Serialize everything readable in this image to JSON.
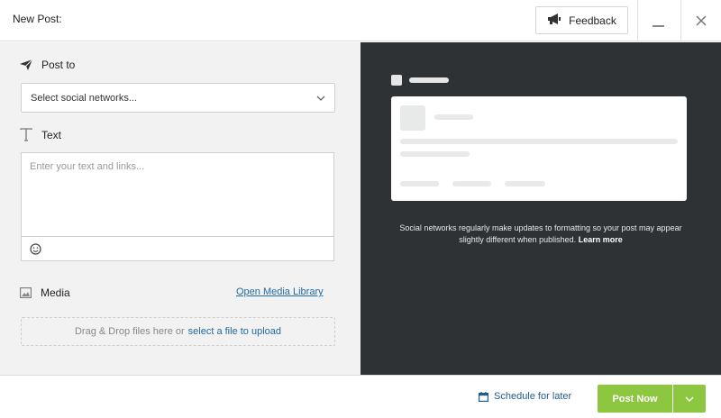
{
  "header": {
    "title": "New Post:",
    "feedback_label": "Feedback"
  },
  "compose": {
    "post_to_label": "Post to",
    "select_placeholder": "Select social networks...",
    "text_label": "Text",
    "text_placeholder": "Enter your text and links...",
    "media_label": "Media",
    "open_media_library": "Open Media Library",
    "dropzone_text": "Drag & Drop files here or",
    "dropzone_link": "select a file to upload"
  },
  "preview": {
    "note": "Social networks regularly make updates to formatting so your post may appear slightly different when published.",
    "learn_more": "Learn more"
  },
  "footer": {
    "schedule_label": "Schedule for later",
    "post_now_label": "Post Now"
  },
  "colors": {
    "accent_green": "#8dc63f",
    "link_blue": "#1f6aa5",
    "preview_bg": "#2f3234"
  },
  "icons": [
    "megaphone-icon",
    "minimize-icon",
    "close-icon",
    "paper-plane-icon",
    "chevron-down-icon",
    "text-icon",
    "emoji-icon",
    "image-icon",
    "calendar-icon"
  ]
}
